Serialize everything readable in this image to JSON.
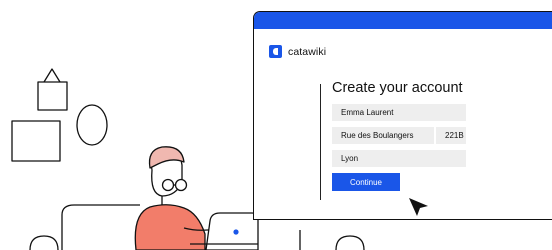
{
  "brand": {
    "name": "catawiki",
    "color": "#1a56e8"
  },
  "form": {
    "title": "Create your account",
    "name_value": "Emma Laurent",
    "street_value": "Rue des Boulangers",
    "number_value": "221B",
    "city_value": "Lyon",
    "continue_label": "Continue"
  },
  "icons": [
    "picture-frame-triangle-icon",
    "picture-frame-oval-icon",
    "picture-frame-rect-icon",
    "person-illustration",
    "laptop-icon",
    "mouse-cursor-icon"
  ]
}
